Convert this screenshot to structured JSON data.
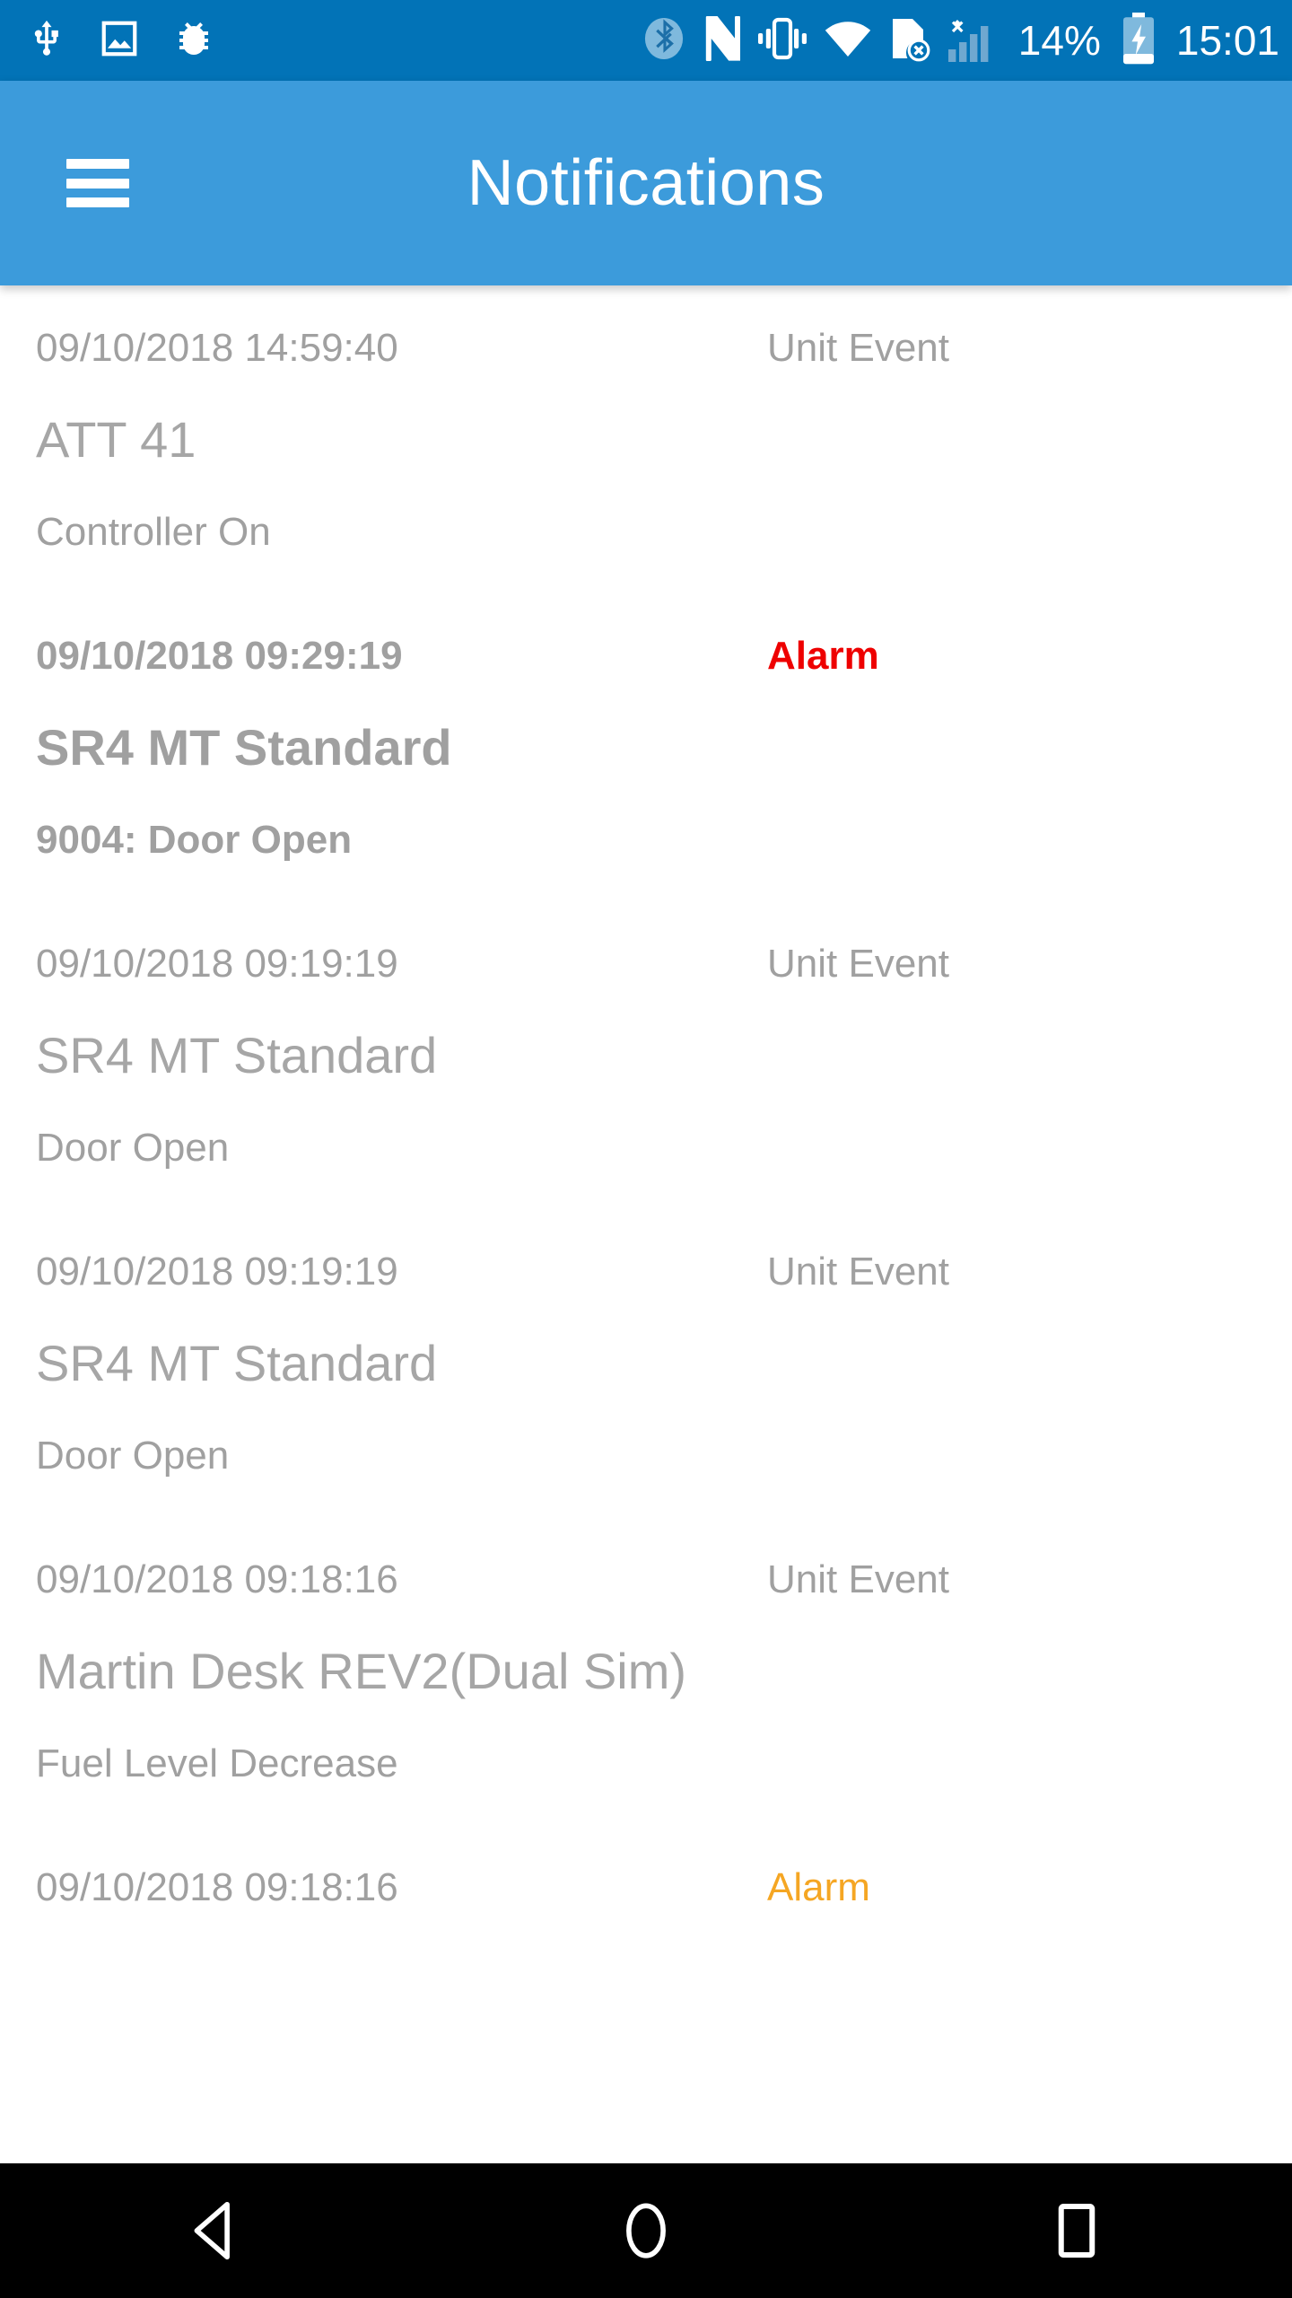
{
  "status_bar": {
    "background_color": "#0273b7",
    "left_icons": [
      {
        "name": "usb-icon",
        "label": "USB"
      },
      {
        "name": "screenshot-icon",
        "label": "Screenshot"
      },
      {
        "name": "debug-bug-icon",
        "label": "USB debugging"
      }
    ],
    "right_icons": [
      {
        "name": "bluetooth-icon",
        "label": "Bluetooth"
      },
      {
        "name": "nfc-icon",
        "label": "NFC"
      },
      {
        "name": "vibrate-icon",
        "label": "Vibrate"
      },
      {
        "name": "wifi-icon",
        "label": "Wi-Fi"
      },
      {
        "name": "sim-card-error-icon",
        "label": "No SIM card"
      },
      {
        "name": "cellular-signal-off-icon",
        "label": "No service"
      }
    ],
    "battery_percent": "14%",
    "battery_icon": "battery-charging-icon",
    "time": "15:01"
  },
  "app_bar": {
    "background_color": "#3c9bdb",
    "menu_icon": "hamburger-menu-icon",
    "title": "Notifications"
  },
  "notifications": [
    {
      "date": "09/10/2018 14:59:40",
      "type": "Unit Event",
      "type_color": "#a0a0a0",
      "title": "ATT 41",
      "description": "Controller On",
      "unread": false
    },
    {
      "date": "09/10/2018 09:29:19",
      "type": "Alarm",
      "type_color": "#ee0000",
      "title": "SR4 MT Standard",
      "description": "9004: Door Open",
      "unread": true
    },
    {
      "date": "09/10/2018 09:19:19",
      "type": "Unit Event",
      "type_color": "#a0a0a0",
      "title": "SR4 MT Standard",
      "description": "Door Open",
      "unread": false
    },
    {
      "date": "09/10/2018 09:19:19",
      "type": "Unit Event",
      "type_color": "#a0a0a0",
      "title": "SR4 MT Standard",
      "description": "Door Open",
      "unread": false
    },
    {
      "date": "09/10/2018 09:18:16",
      "type": "Unit Event",
      "type_color": "#a0a0a0",
      "title": "Martin Desk REV2(Dual Sim)",
      "description": "Fuel Level Decrease",
      "unread": false
    },
    {
      "date": "09/10/2018 09:18:16",
      "type": "Alarm",
      "type_color": "#f5a623",
      "title": "",
      "description": "",
      "unread": false
    }
  ],
  "nav_bar": {
    "background_color": "#000000",
    "buttons": [
      {
        "name": "nav-back-button",
        "label": "Back"
      },
      {
        "name": "nav-home-button",
        "label": "Home"
      },
      {
        "name": "nav-recents-button",
        "label": "Recents"
      }
    ]
  }
}
